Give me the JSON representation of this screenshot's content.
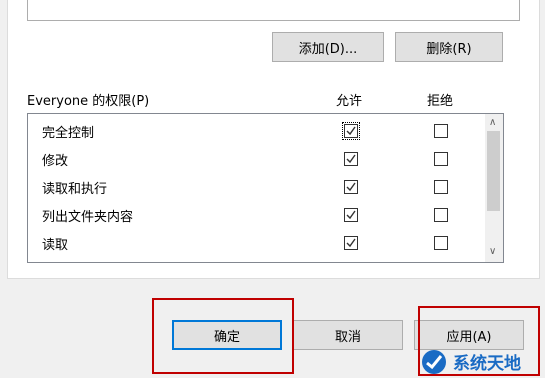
{
  "buttons": {
    "add_label": "添加(D)...",
    "remove_label": "删除(R)",
    "ok_label": "确定",
    "cancel_label": "取消",
    "apply_label": "应用(A)"
  },
  "permissions": {
    "title": "Everyone 的权限(P)",
    "allow_header": "允许",
    "deny_header": "拒绝",
    "rows": [
      {
        "label": "完全控制",
        "allow": true,
        "deny": false
      },
      {
        "label": "修改",
        "allow": true,
        "deny": false
      },
      {
        "label": "读取和执行",
        "allow": true,
        "deny": false
      },
      {
        "label": "列出文件夹内容",
        "allow": true,
        "deny": false
      },
      {
        "label": "读取",
        "allow": true,
        "deny": false
      }
    ]
  },
  "watermark": {
    "text": "系统天地"
  },
  "colors": {
    "highlight_box": "#c00000",
    "focus_border": "#0078d7"
  }
}
